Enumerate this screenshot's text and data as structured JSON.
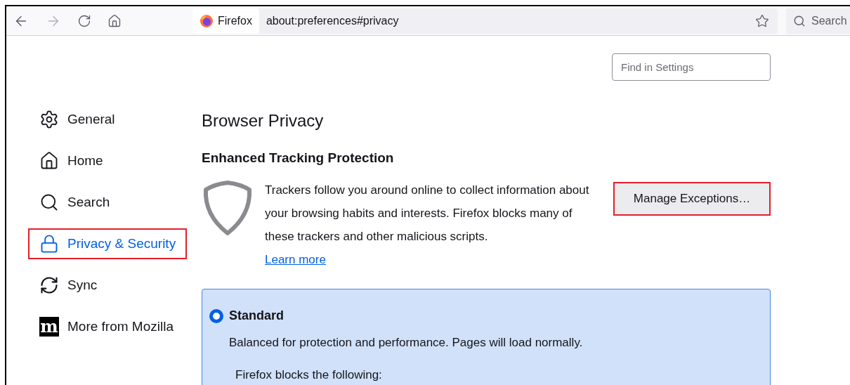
{
  "toolbar": {
    "back_disabled": false,
    "forward_disabled": true,
    "identity": "Firefox",
    "url": "about:preferences#privacy",
    "search": "Search"
  },
  "find": {
    "placeholder": "Find in Settings"
  },
  "sidebar": {
    "items": [
      {
        "label": "General",
        "selected": false,
        "highlighted": false
      },
      {
        "label": "Home",
        "selected": false,
        "highlighted": false
      },
      {
        "label": "Search",
        "selected": false,
        "highlighted": false
      },
      {
        "label": "Privacy & Security",
        "selected": true,
        "highlighted": true
      },
      {
        "label": "Sync",
        "selected": false,
        "highlighted": false
      },
      {
        "logo": "m",
        "label": "More from Mozilla",
        "selected": false,
        "highlighted": false
      }
    ]
  },
  "main": {
    "title": "Browser Privacy",
    "section": "Enhanced Tracking Protection",
    "description": "Trackers follow you around online to collect information about your browsing habits and interests. Firefox blocks many of these trackers and other malicious scripts.",
    "learn_more": "Learn more",
    "button": {
      "label": "Manage Exceptions…",
      "highlighted": true
    },
    "options": [
      {
        "label": "Standard",
        "selected": true,
        "description": "Balanced for protection and performance. Pages will load normally.",
        "blocks_heading": "Firefox blocks the following:"
      }
    ]
  }
}
